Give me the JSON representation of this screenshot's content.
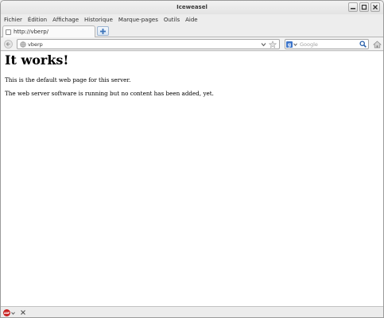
{
  "window": {
    "title": "Iceweasel"
  },
  "menubar": {
    "items": [
      {
        "label": "Fichier"
      },
      {
        "label": "Édition"
      },
      {
        "label": "Affichage"
      },
      {
        "label": "Historique"
      },
      {
        "label": "Marque-pages"
      },
      {
        "label": "Outils"
      },
      {
        "label": "Aide"
      }
    ]
  },
  "tabs": [
    {
      "label": "http://vberp/",
      "favicon": "blank-page-icon",
      "active": true
    }
  ],
  "navbar": {
    "url": "vberp",
    "search_placeholder": "Google",
    "search_engine_icon": "google-search-icon"
  },
  "page": {
    "heading": "It works!",
    "paragraphs": [
      "This is the default web page for this server.",
      "The web server software is running but no content has been added, yet."
    ]
  },
  "statusbar": {
    "addon_icon": "adblock-plus-icon",
    "addon_icon_text": "ABP"
  },
  "colors": {
    "search_engine": "#3c74c9",
    "adblock_red": "#c8201f",
    "newtab_blue": "#3b73b9"
  }
}
